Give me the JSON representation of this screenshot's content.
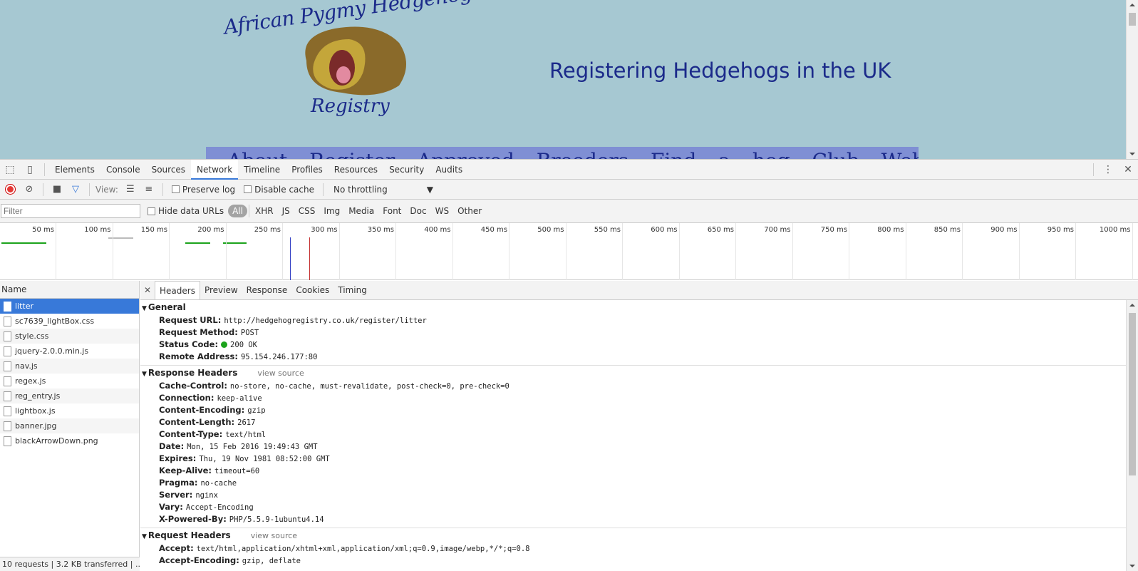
{
  "site": {
    "logo_top": "African Pygmy Hedgehog Club",
    "logo_bottom": "Registry",
    "title": "Registering Hedgehogs in the UK",
    "nav_text": "About   Register   Approved Breeders   Find a hog   Club Website   Hedgehog N"
  },
  "devtools": {
    "tabs": [
      "Elements",
      "Console",
      "Sources",
      "Network",
      "Timeline",
      "Profiles",
      "Resources",
      "Security",
      "Audits"
    ],
    "active_tab": "Network",
    "toolbar": {
      "view_label": "View:",
      "preserve_log": "Preserve log",
      "disable_cache": "Disable cache",
      "throttling": "No throttling"
    },
    "filter": {
      "placeholder": "Filter",
      "hide_data_urls": "Hide data URLs",
      "types": [
        "All",
        "XHR",
        "JS",
        "CSS",
        "Img",
        "Media",
        "Font",
        "Doc",
        "WS",
        "Other"
      ]
    },
    "timeline_ticks": [
      "50 ms",
      "100 ms",
      "150 ms",
      "200 ms",
      "250 ms",
      "300 ms",
      "350 ms",
      "400 ms",
      "450 ms",
      "500 ms",
      "550 ms",
      "600 ms",
      "650 ms",
      "700 ms",
      "750 ms",
      "800 ms",
      "850 ms",
      "900 ms",
      "950 ms",
      "1000 ms"
    ],
    "requests_header": "Name",
    "requests": [
      "litter",
      "sc7639_lightBox.css",
      "style.css",
      "jquery-2.0.0.min.js",
      "nav.js",
      "regex.js",
      "reg_entry.js",
      "lightbox.js",
      "banner.jpg",
      "blackArrowDown.png"
    ],
    "summary": "10 requests  |  3.2 KB transferred  |  ...",
    "detail_tabs": [
      "Headers",
      "Preview",
      "Response",
      "Cookies",
      "Timing"
    ],
    "general": {
      "title": "General",
      "rows": [
        {
          "key": "Request URL:",
          "value": "http://hedgehogregistry.co.uk/register/litter"
        },
        {
          "key": "Request Method:",
          "value": "POST"
        },
        {
          "key": "Status Code:",
          "value": "200 OK"
        },
        {
          "key": "Remote Address:",
          "value": "95.154.246.177:80"
        }
      ]
    },
    "response_headers": {
      "title": "Response Headers",
      "view_source": "view source",
      "rows": [
        {
          "key": "Cache-Control:",
          "value": "no-store, no-cache, must-revalidate, post-check=0, pre-check=0"
        },
        {
          "key": "Connection:",
          "value": "keep-alive"
        },
        {
          "key": "Content-Encoding:",
          "value": "gzip"
        },
        {
          "key": "Content-Length:",
          "value": "2617"
        },
        {
          "key": "Content-Type:",
          "value": "text/html"
        },
        {
          "key": "Date:",
          "value": "Mon, 15 Feb 2016 19:49:43 GMT"
        },
        {
          "key": "Expires:",
          "value": "Thu, 19 Nov 1981 08:52:00 GMT"
        },
        {
          "key": "Keep-Alive:",
          "value": "timeout=60"
        },
        {
          "key": "Pragma:",
          "value": "no-cache"
        },
        {
          "key": "Server:",
          "value": "nginx"
        },
        {
          "key": "Vary:",
          "value": "Accept-Encoding"
        },
        {
          "key": "X-Powered-By:",
          "value": "PHP/5.5.9-1ubuntu4.14"
        }
      ]
    },
    "request_headers": {
      "title": "Request Headers",
      "view_source": "view source",
      "rows": [
        {
          "key": "Accept:",
          "value": "text/html,application/xhtml+xml,application/xml;q=0.9,image/webp,*/*;q=0.8"
        },
        {
          "key": "Accept-Encoding:",
          "value": "gzip, deflate"
        }
      ]
    }
  }
}
